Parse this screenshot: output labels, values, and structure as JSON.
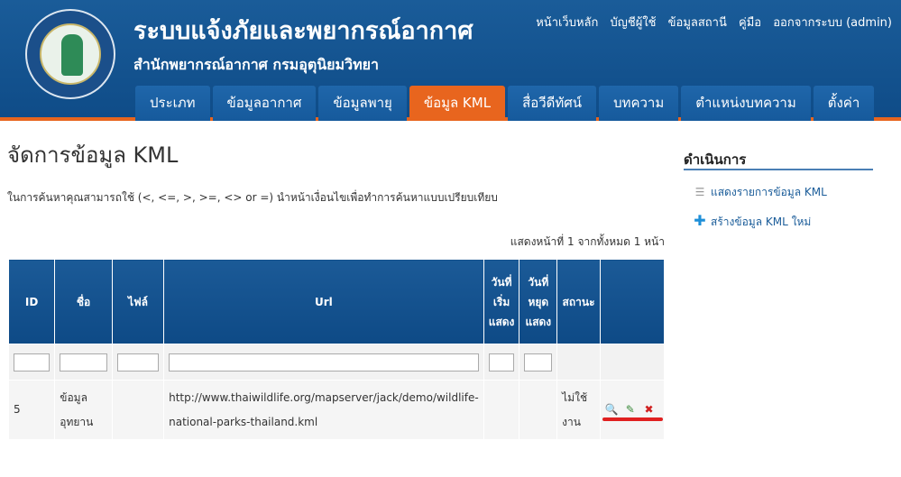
{
  "header": {
    "title": "ระบบแจ้งภัยและพยากรณ์อากาศ",
    "subtitle": "สำนักพยากรณ์อากาศ กรมอุตุนิยมวิทยา",
    "logo_icon": "meteorological-department-seal-icon"
  },
  "top_links": [
    "หน้าเว็บหลัก",
    "บัญชีผู้ใช้",
    "ข้อมูลสถานี",
    "คู่มือ",
    "ออกจากระบบ (admin)"
  ],
  "nav": {
    "tabs": [
      "ประเภท",
      "ข้อมูลอากาศ",
      "ข้อมูลพายุ",
      "ข้อมูล KML",
      "สื่อวีดีทัศน์",
      "บทความ",
      "ตำแหน่งบทความ",
      "ตั้งค่า"
    ],
    "active": "ข้อมูล KML"
  },
  "main": {
    "page_title": "จัดการข้อมูล KML",
    "search_hint": "ในการค้นหาคุณสามารถใช้ (<, <=, >, >=, <> or =) นำหน้าเงื่อนไขเพื่อทำการค้นหาแบบเปรียบเทียบ",
    "pager": "แสดงหน้าที่ 1 จากทั้งหมด 1 หน้า"
  },
  "table": {
    "columns": [
      "ID",
      "ชื่อ",
      "ไฟล์",
      "Url",
      "วันที่ เริ่ม แสดง",
      "วันที่ หยุด แสดง",
      "สถานะ",
      ""
    ],
    "rows": [
      {
        "id": "5",
        "name": "ข้อมูล อุทยาน",
        "file": "",
        "url": "http://www.thaiwildlife.org/mapserver/jack/demo/wildlife-national-parks-thailand.kml",
        "start": "",
        "stop": "",
        "status": "ไม่ใช้ งาน",
        "actions": [
          "view-icon",
          "edit-icon",
          "delete-icon"
        ]
      }
    ]
  },
  "sidebar": {
    "title": "ดำเนินการ",
    "items": [
      {
        "label": "แสดงรายการข้อมูล KML",
        "icon": "list-icon"
      },
      {
        "label": "สร้างข้อมูล KML ใหม่",
        "icon": "add-icon"
      }
    ]
  },
  "colors": {
    "header_blue": "#0f4c88",
    "accent_orange": "#e8651e",
    "annotation_red": "#e02020"
  }
}
